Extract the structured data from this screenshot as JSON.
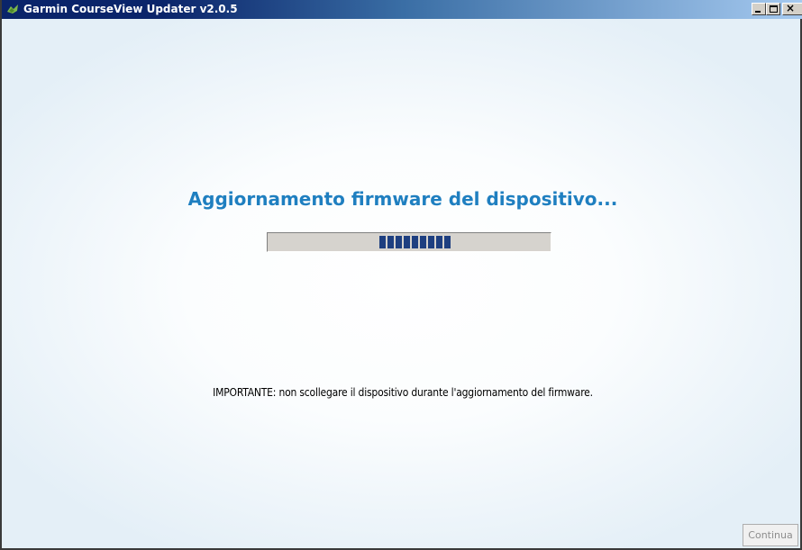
{
  "window": {
    "title": "Garmin CourseView Updater v2.0.5",
    "controls": {
      "minimize_icon": "minimize-icon",
      "maximize_icon": "maximize-icon",
      "close_glyph": "×"
    },
    "app_icon": "garmin-app-icon"
  },
  "main": {
    "headline": "Aggiornamento firmware del dispositivo...",
    "progress": {
      "style": "indeterminate-marquee",
      "color": "#1e3f80"
    },
    "notice": "IMPORTANTE: non scollegare il dispositivo durante l'aggiornamento del firmware."
  },
  "footer": {
    "continue_label": "Continua",
    "continue_enabled": false
  },
  "colors": {
    "headline": "#1f7fc0",
    "titlebar_start": "#0a246a",
    "titlebar_end": "#a6caf0"
  }
}
